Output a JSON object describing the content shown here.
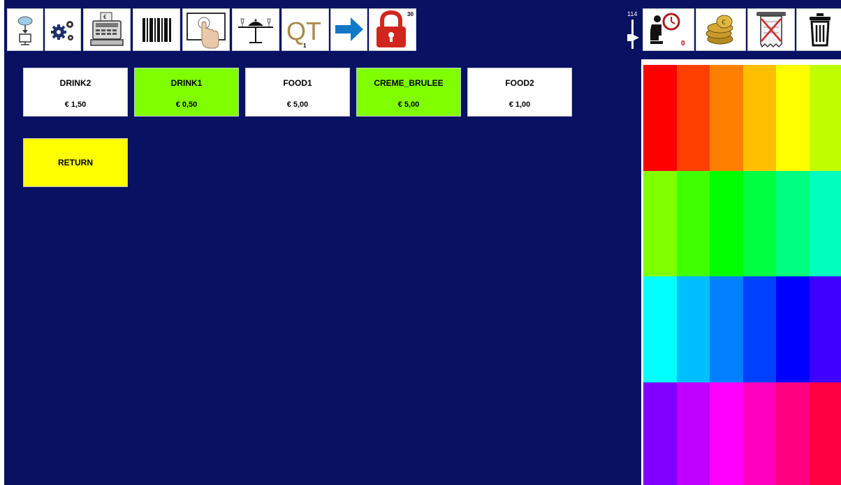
{
  "toolbar": {
    "buttons": [
      {
        "name": "cloud-sync-button",
        "icon": "cloud-download-icon"
      },
      {
        "name": "settings-button",
        "icon": "gears-icon"
      },
      {
        "name": "cash-register-button",
        "icon": "cash-register-icon"
      },
      {
        "name": "barcode-button",
        "icon": "barcode-icon"
      },
      {
        "name": "touch-screen-button",
        "icon": "touch-screen-icon"
      },
      {
        "name": "table-service-button",
        "icon": "table-service-icon"
      },
      {
        "name": "quantity-button",
        "icon": "qt-icon",
        "label": "QT",
        "badge": "1"
      },
      {
        "name": "next-button",
        "icon": "arrow-right-icon"
      },
      {
        "name": "lock-button",
        "icon": "padlock-icon",
        "badge": "30"
      }
    ],
    "slider_value": "114",
    "right_buttons": [
      {
        "name": "waiter-button",
        "icon": "waiter-clock-icon",
        "badge": "0"
      },
      {
        "name": "coins-button",
        "icon": "coins-icon"
      },
      {
        "name": "void-receipt-button",
        "icon": "void-receipt-icon"
      },
      {
        "name": "trash-button",
        "icon": "trash-icon"
      }
    ]
  },
  "items": [
    {
      "name": "DRINK2",
      "price": "€ 1,50",
      "active": false
    },
    {
      "name": "DRINK1",
      "price": "€ 0,50",
      "active": true
    },
    {
      "name": "FOOD1",
      "price": "€ 5,00",
      "active": false
    },
    {
      "name": "CREME_BRULEE",
      "price": "€ 5,00",
      "active": true
    },
    {
      "name": "FOOD2",
      "price": "€ 1,00",
      "active": false
    }
  ],
  "return_label": "RETURN",
  "colors": {
    "background": "#081162",
    "active_item": "#80ff00",
    "return_button": "#ffff00"
  },
  "palette": [
    [
      "#ff0000",
      "#ff4000",
      "#ff8000",
      "#ffbf00",
      "#ffff00",
      "#bfff00"
    ],
    [
      "#80ff00",
      "#40ff00",
      "#00ff00",
      "#00ff40",
      "#00ff80",
      "#00ffbf"
    ],
    [
      "#00ffff",
      "#00bfff",
      "#0080ff",
      "#0040ff",
      "#0000ff",
      "#4000ff"
    ],
    [
      "#8000ff",
      "#bf00ff",
      "#ff00ff",
      "#ff00bf",
      "#ff0080",
      "#ff0040"
    ]
  ]
}
